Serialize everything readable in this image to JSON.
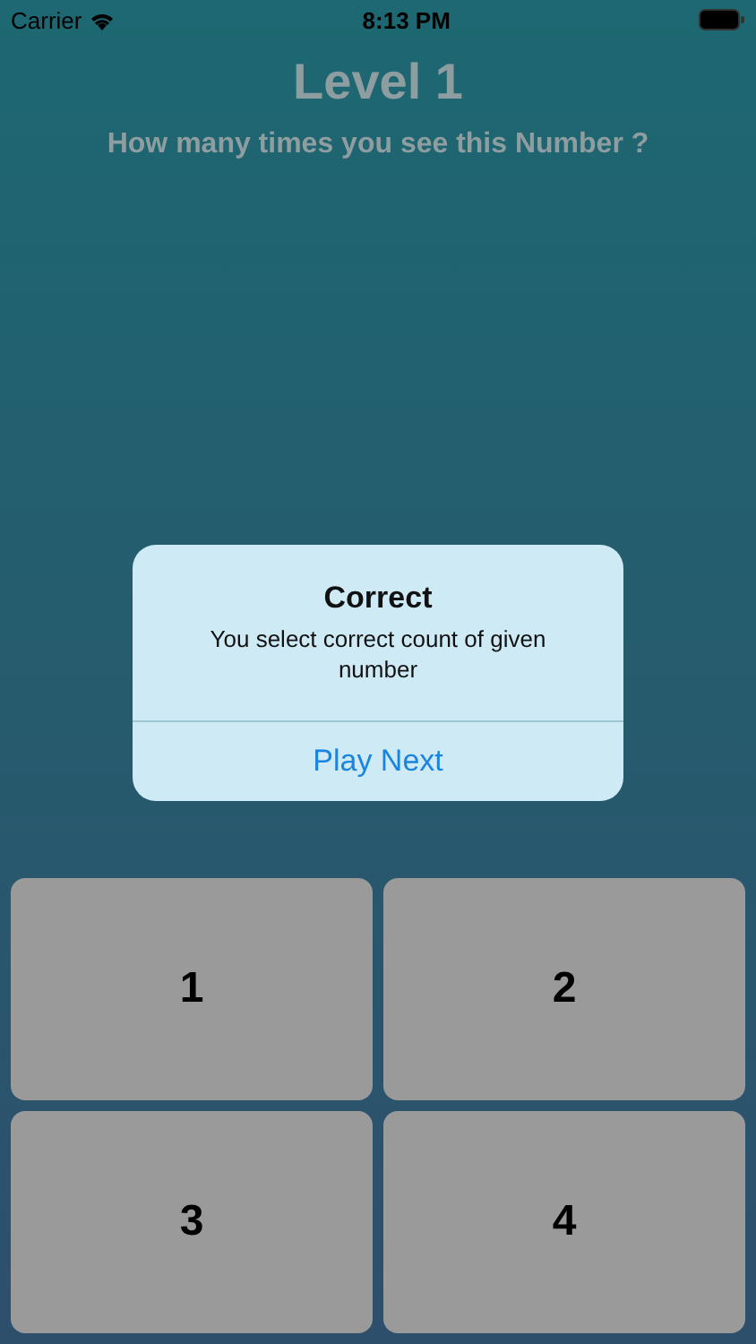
{
  "status_bar": {
    "carrier": "Carrier",
    "time": "8:13 PM"
  },
  "title": "Level 1",
  "question": "How many times you see this Number ?",
  "alert": {
    "title": "Correct",
    "message": "You select correct count of given number",
    "action": "Play Next"
  },
  "answers": [
    "1",
    "2",
    "3",
    "4"
  ]
}
